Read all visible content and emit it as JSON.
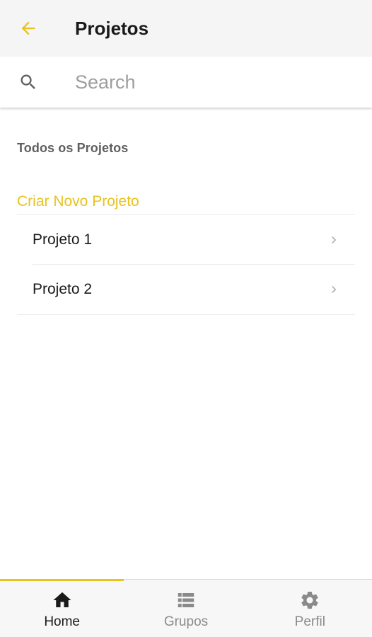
{
  "header": {
    "title": "Projetos",
    "back_icon": "arrow-back-icon",
    "accent_color": "#e8c21f"
  },
  "search": {
    "placeholder": "Search",
    "value": "",
    "icon": "search-icon"
  },
  "section": {
    "title": "Todos os Projetos",
    "create_label": "Criar Novo Projeto"
  },
  "projects": [
    {
      "label": "Projeto 1",
      "icon": "chevron-right-icon"
    },
    {
      "label": "Projeto 2",
      "icon": "chevron-right-icon"
    }
  ],
  "bottom_nav": {
    "active": "Home",
    "tabs": [
      {
        "label": "Home",
        "icon": "home-icon"
      },
      {
        "label": "Grupos",
        "icon": "list-icon"
      },
      {
        "label": "Perfil",
        "icon": "gear-icon"
      }
    ]
  }
}
